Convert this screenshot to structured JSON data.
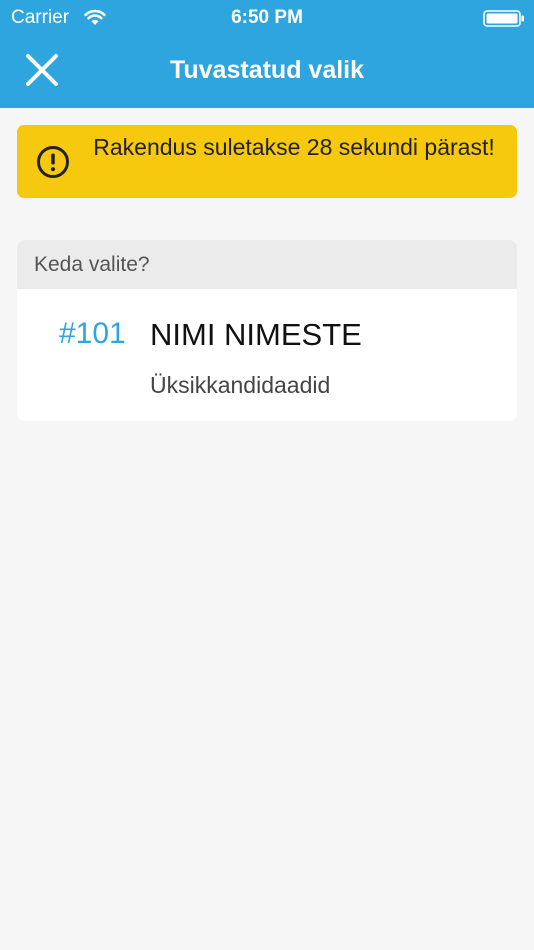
{
  "status_bar": {
    "carrier": "Carrier",
    "time": "6:50 PM",
    "wifi_icon": "wifi-icon",
    "battery_icon": "battery-icon"
  },
  "nav": {
    "title": "Tuvastatud valik",
    "close_icon": "close-icon",
    "background_color": "#2fa5df"
  },
  "warning": {
    "text": "Rakendus suletakse 28 sekundi pärast!",
    "icon": "exclamation-circle-icon",
    "background_color": "#f6c90e"
  },
  "selection": {
    "header": "Keda valite?",
    "candidate": {
      "number": "#101",
      "name": "NIMI NIMESTE",
      "group": "Üksikkandidaadid"
    }
  }
}
